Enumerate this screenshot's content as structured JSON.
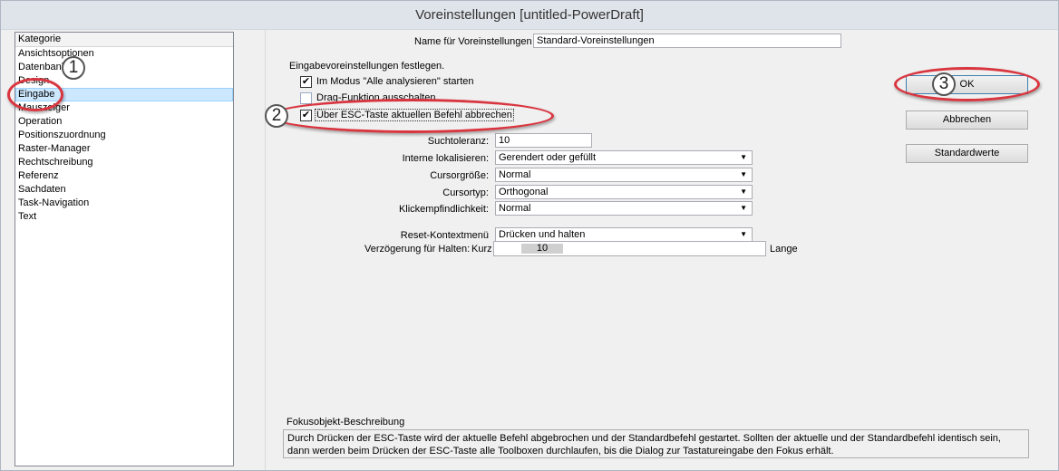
{
  "window": {
    "title": "Voreinstellungen [untitled-PowerDraft]"
  },
  "categories": {
    "header": "Kategorie",
    "items": [
      "Ansichtsoptionen",
      "Datenbank",
      "Design",
      "Eingabe",
      "Mauszeiger",
      "Operation",
      "Positionszuordnung",
      "Raster-Manager",
      "Rechtschreibung",
      "Referenz",
      "Sachdaten",
      "Task-Navigation",
      "Text"
    ],
    "selected": "Eingabe"
  },
  "settings": {
    "name_label": "Name für Voreinstellungen",
    "name_value": "Standard-Voreinstellungen",
    "group_label": "Eingabevoreinstellungen festlegen.",
    "checkboxes": [
      {
        "label": "Im Modus \"Alle analysieren\" starten",
        "checked": true
      },
      {
        "label": "Drag-Funktion ausschalten",
        "checked": false
      },
      {
        "label": "Über ESC-Taste aktuellen Befehl abbrechen",
        "checked": true
      }
    ],
    "check_mark": "✔",
    "fields": [
      {
        "label": "Suchtoleranz:",
        "value": "10",
        "type": "textbox"
      },
      {
        "label": "Interne lokalisieren:",
        "value": "Gerendert oder gefüllt",
        "type": "combo"
      },
      {
        "label": "Cursorgröße:",
        "value": "Normal",
        "type": "combo"
      },
      {
        "label": "Cursortyp:",
        "value": "Orthogonal",
        "type": "combo"
      },
      {
        "label": "Klickempfindlichkeit:",
        "value": "Normal",
        "type": "combo"
      },
      {
        "label": "Reset-Kontextmenü",
        "value": "Drücken und halten",
        "type": "combo"
      }
    ],
    "delay": {
      "label": "Verzögerung für Halten:",
      "min_label": "Kurz",
      "max_label": "Lange",
      "value": "10"
    },
    "dropdown_arrow": "▼"
  },
  "buttons": {
    "ok": "OK",
    "cancel": "Abbrechen",
    "defaults": "Standardwerte"
  },
  "description": {
    "label": "Fokusobjekt-Beschreibung",
    "text": "Durch Drücken der ESC-Taste wird der aktuelle Befehl abgebrochen und der Standardbefehl gestartet. Sollten der aktuelle und der Standardbefehl identisch sein, dann werden beim Drücken der ESC-Taste alle Toolboxen durchlaufen, bis die Dialog zur Tastatureingabe den Fokus erhält."
  },
  "annotations": [
    "1",
    "2",
    "3"
  ],
  "colors": {
    "annotation_ring": "#d9353f",
    "selection": "#cce8ff"
  }
}
